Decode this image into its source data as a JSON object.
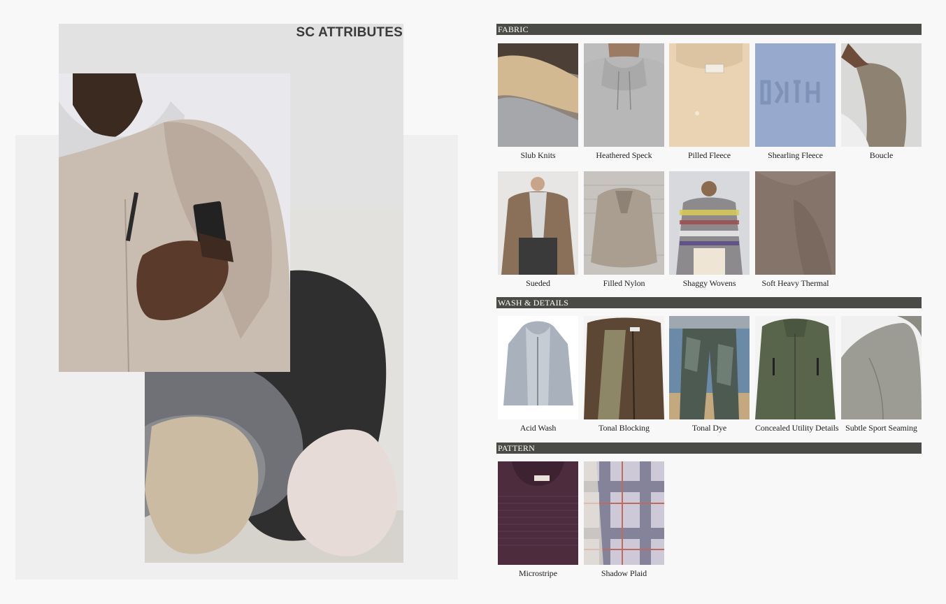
{
  "collage": {
    "title": "SC ATTRIBUTES",
    "jacket_photo": "model-in-beige-overshirt-with-hood",
    "shapes_photo": "abstract-paper-shapes"
  },
  "sections": [
    {
      "label": "FABRIC",
      "items": [
        {
          "caption": "Slub Knits"
        },
        {
          "caption": "Heathered Speck"
        },
        {
          "caption": "Pilled Fleece"
        },
        {
          "caption": "Shearling Fleece"
        },
        {
          "caption": "Boucle"
        },
        {
          "caption": "Sueded"
        },
        {
          "caption": "Filled Nylon"
        },
        {
          "caption": "Shaggy Wovens"
        },
        {
          "caption": "Soft Heavy Thermal"
        }
      ]
    },
    {
      "label": "WASH & DETAILS",
      "items": [
        {
          "caption": "Acid Wash"
        },
        {
          "caption": "Tonal Blocking"
        },
        {
          "caption": "Tonal Dye"
        },
        {
          "caption": "Concealed Utility Details"
        },
        {
          "caption": "Subtle Sport Seaming"
        }
      ]
    },
    {
      "label": "PATTERN",
      "items": [
        {
          "caption": "Microstripe"
        },
        {
          "caption": "Shadow Plaid"
        }
      ]
    }
  ]
}
